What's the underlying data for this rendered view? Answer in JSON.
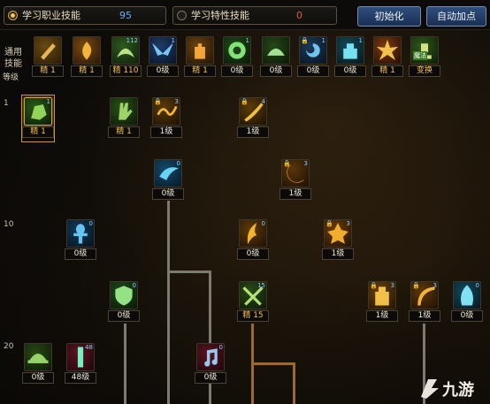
{
  "tabs": [
    {
      "label": "学习职业技能",
      "count": "95",
      "active": true
    },
    {
      "label": "学习特性技能",
      "count": "0",
      "active": false
    }
  ],
  "buttons": {
    "reset": "初始化",
    "auto": "自动加点"
  },
  "side": {
    "common_line1": "通用",
    "common_line2": "技能",
    "level": "等级"
  },
  "row_levels": [
    "1",
    "10",
    "20"
  ],
  "common_skills": [
    {
      "icon": "scroll-pen-icon",
      "level": "精 1",
      "gold": true
    },
    {
      "icon": "flame-book-icon",
      "level": "精 1",
      "gold": true
    },
    {
      "icon": "spirit-summon-icon",
      "level": "精 110",
      "gold": true,
      "count": "112"
    },
    {
      "icon": "wings-icon",
      "level": "0级",
      "gold": false,
      "count": "1"
    },
    {
      "icon": "fire-hand-icon",
      "level": "精 1",
      "gold": true
    },
    {
      "icon": "target-ring-icon",
      "level": "0级",
      "gold": false,
      "count": "1"
    },
    {
      "icon": "rune-circle-icon",
      "level": "0级",
      "gold": false
    },
    {
      "icon": "vortex-lock-icon",
      "level": "0级",
      "gold": false,
      "lock": true,
      "count": "1"
    },
    {
      "icon": "armored-figure-icon",
      "level": "0级",
      "gold": false,
      "count": "1"
    },
    {
      "icon": "explosion-icon",
      "level": "精 1",
      "gold": true
    },
    {
      "icon": "swap-scroll-icon",
      "level": "变换",
      "gold": true,
      "tag": "魔法"
    }
  ],
  "tree_skills": [
    {
      "name": "skill-palm-strike",
      "icon": "green-fist-icon",
      "level": "精 1",
      "gold": true,
      "count": "1",
      "selected": true
    },
    {
      "name": "skill-claw-slash",
      "icon": "green-hand-icon",
      "level": "精 1",
      "gold": true
    },
    {
      "name": "skill-golden-wave",
      "icon": "gold-wave-icon",
      "level": "1级",
      "gold": false,
      "lock": true,
      "count": "3"
    },
    {
      "name": "skill-golden-swipe",
      "icon": "gold-slash-icon",
      "level": "1级",
      "gold": false,
      "lock": true,
      "count": "4"
    },
    {
      "name": "skill-water-dash",
      "icon": "blue-dash-icon",
      "level": "0级",
      "gold": false,
      "count": "0"
    },
    {
      "name": "skill-fire-crescent",
      "icon": "fire-crescent-icon",
      "level": "1级",
      "gold": false,
      "lock": true,
      "count": "3"
    },
    {
      "name": "skill-ankh",
      "icon": "ankh-icon",
      "level": "0级",
      "gold": false,
      "count": "0"
    },
    {
      "name": "skill-flame-feather",
      "icon": "flame-feather-icon",
      "level": "0级",
      "gold": false,
      "count": "0"
    },
    {
      "name": "skill-burst-fist",
      "icon": "burst-fist-icon",
      "level": "1级",
      "gold": false,
      "lock": true,
      "count": "3"
    },
    {
      "name": "skill-shield-ward",
      "icon": "shield-icon",
      "level": "0级",
      "gold": false,
      "count": "0"
    },
    {
      "name": "skill-cross-blades",
      "icon": "cross-blades-icon",
      "level": "精 15",
      "gold": true,
      "count": "15"
    },
    {
      "name": "skill-golden-idol",
      "icon": "golden-idol-icon",
      "level": "1级",
      "gold": false,
      "lock": true,
      "count": "3"
    },
    {
      "name": "skill-arc-bow",
      "icon": "arc-bow-icon",
      "level": "1级",
      "gold": false,
      "lock": true,
      "count": "3"
    },
    {
      "name": "skill-ice-spirit",
      "icon": "ice-spirit-icon",
      "level": "0级",
      "gold": false,
      "count": "0"
    },
    {
      "name": "skill-leaf-hat",
      "icon": "leaf-hat-icon",
      "level": "0级",
      "gold": false
    },
    {
      "name": "skill-jade-pillar",
      "icon": "jade-pillar-icon",
      "level": "48级",
      "gold": false,
      "count": "48"
    },
    {
      "name": "skill-music-note",
      "icon": "music-note-icon",
      "level": "0级",
      "gold": false,
      "count": "0"
    }
  ],
  "colors": {
    "accent_gold": "#f3c050",
    "count_blue": "#5fb0ff",
    "count_red": "#e25c3e",
    "button_blue": "#2f4e7c"
  },
  "watermark": "九游"
}
